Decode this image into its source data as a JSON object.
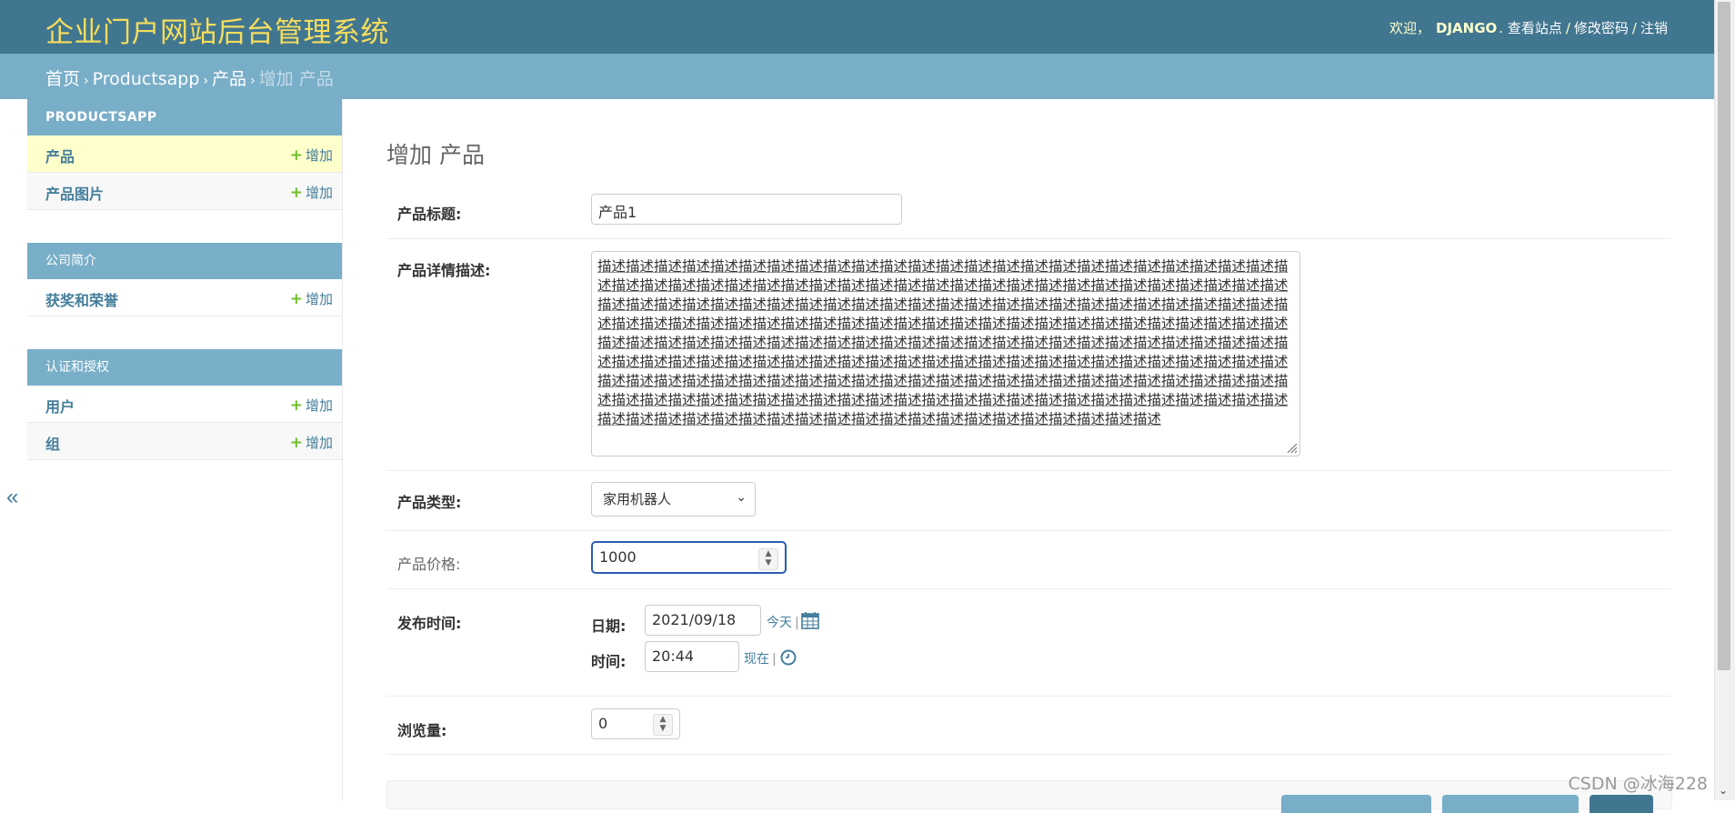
{
  "header": {
    "site_title": "企业门户网站后台管理系统",
    "welcome": "欢迎，",
    "username": "DJANGO",
    "view_site": "查看站点",
    "change_password": "修改密码",
    "logout": "注销",
    "separator": "/"
  },
  "breadcrumbs": {
    "home": "首页",
    "app": "Productsapp",
    "model": "产品",
    "current": "增加 产品",
    "separator": "›"
  },
  "sidebar": {
    "collapse_icon": "«",
    "modules": [
      {
        "caption": "PRODUCTSAPP",
        "models": [
          {
            "name": "产品",
            "add": "增加"
          },
          {
            "name": "产品图片",
            "add": "增加"
          }
        ]
      },
      {
        "caption": "公司简介",
        "models": [
          {
            "name": "获奖和荣誉",
            "add": "增加"
          }
        ]
      },
      {
        "caption": "认证和授权",
        "models": [
          {
            "name": "用户",
            "add": "增加"
          },
          {
            "name": "组",
            "add": "增加"
          }
        ]
      }
    ]
  },
  "form": {
    "page_title": "增加 产品",
    "title_label": "产品标题:",
    "title_value": "产品1",
    "desc_label": "产品详情描述:",
    "desc_value": "描述描述描述描述描述描述描述描述描述描述描述描述描述描述描述描述描述描述描述描述描述描述描述描述描述描述描述描述描述描述描述描述描述描述描述描述描述描述描述描述描述描述描述描述描述描述描述描述描述描述描述描述描述描述描述描述描述描述描述描述描述描述描述描述描述描述描述描述描述描述描述描述描述描述描述描述描述描述描述描述描述描述描述描述描述描述描述描述描述描述描述描述描述描述描述描述描述描述描述描述描述描述描述描述描述描述描述描述描述描述描述描述描述描述描述描述描述描述描述描述描述描述描述描述描述描述描述描述描述描述描述描述描述描述描述描述描述描述描述描述描述描述描述描述描述描述描述描述描述描述描述描述描述描述描述描述描述描述描述描述描述描述描述描述描述描述描述描述描述描述描述描述描述描述描述描述描述描述描述描述描述描述描述描述描述描述描述描述描述描述描述描述描述描述描述描述描述描述描述描述描述描述描述描述描述描述描述描述描述描述描述描述描述描述描述描述",
    "type_label": "产品类型:",
    "type_value": "家用机器人",
    "price_label": "产品价格:",
    "price_value": "1000",
    "pubtime_label": "发布时间:",
    "date_label": "日期:",
    "date_value": "2021/09/18",
    "today_link": "今天",
    "time_label": "时间:",
    "time_value": "20:44",
    "now_link": "现在",
    "views_label": "浏览量:",
    "views_value": "0"
  },
  "icons": {
    "calendar": "calendar-icon",
    "clock": "clock-icon",
    "add": "plus-icon"
  },
  "colors": {
    "header_bg": "#417690",
    "breadcrumb_bg": "#79aec8",
    "branding": "#f5dd5d",
    "link": "#447e9b",
    "add_plus": "#70bf2b",
    "current_row": "#ffffcc"
  },
  "watermark": "CSDN @冰海228"
}
